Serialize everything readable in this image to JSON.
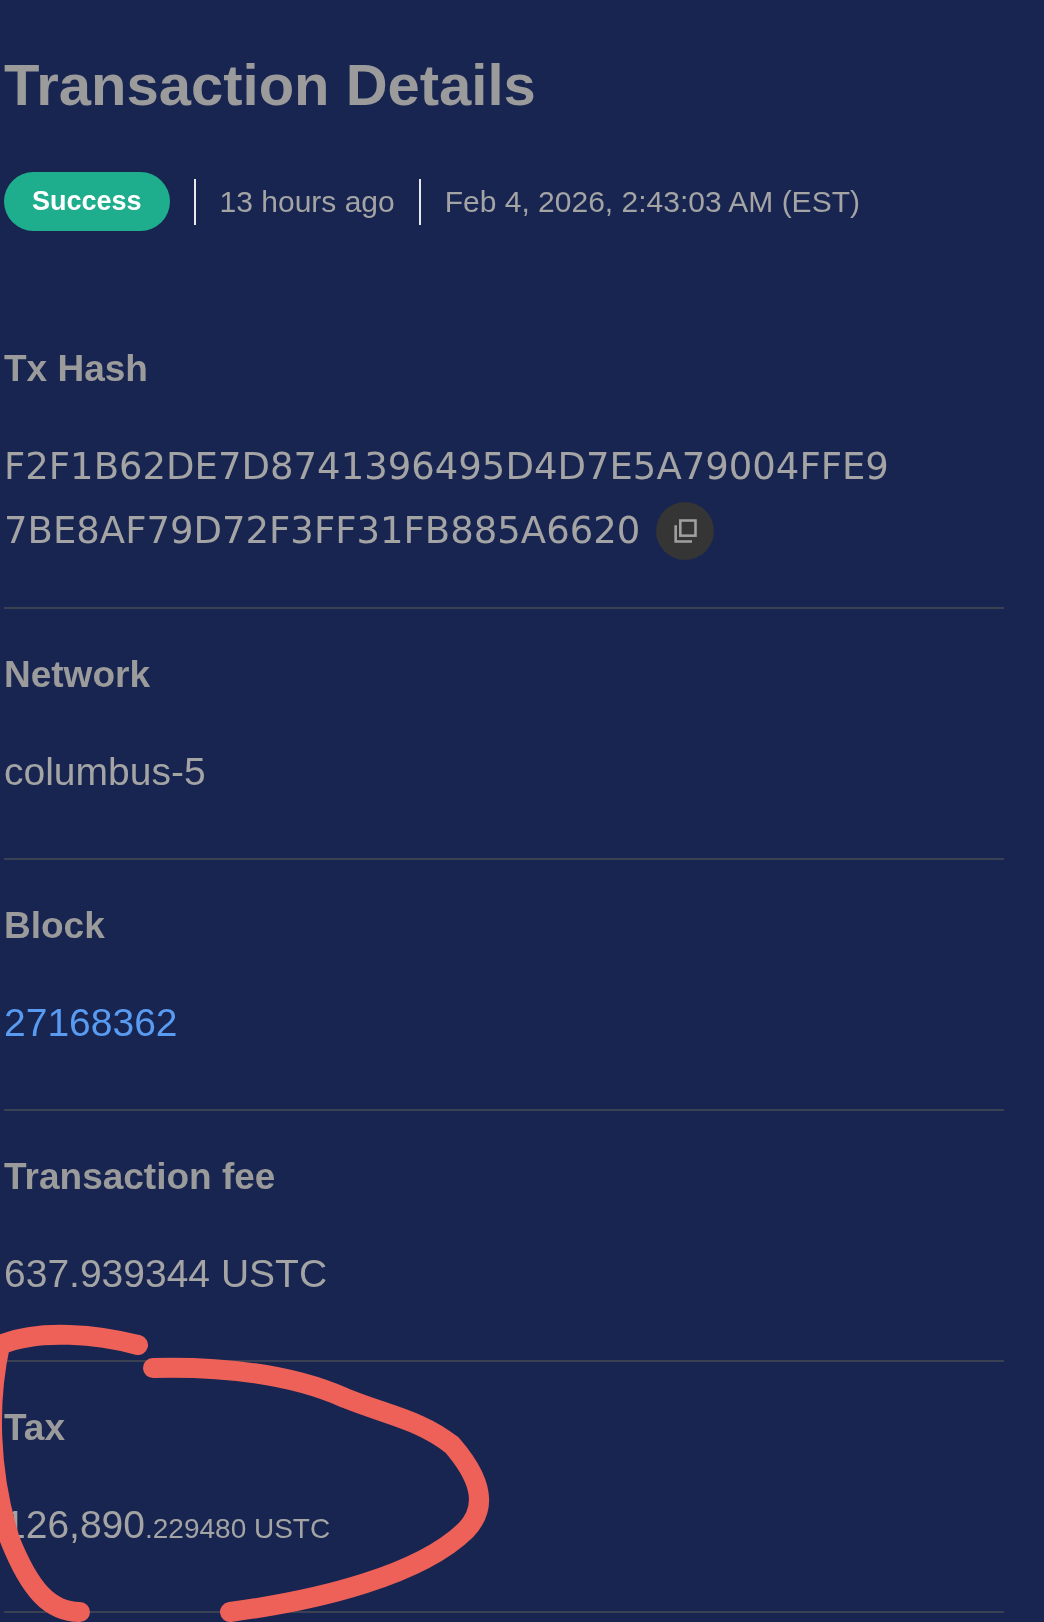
{
  "title": "Transaction Details",
  "status": {
    "label": "Success",
    "kind": "success"
  },
  "time_ago": "13 hours ago",
  "timestamp": "Feb 4, 2026, 2:43:03 AM (EST)",
  "fields": [
    {
      "label": "Tx Hash",
      "kind": "hash",
      "value": "F2F1B62DE7D8741396495D4D7E5A79004FFE9",
      "value_line_2": "7BE8AF79D72F3FF31FB885A6620"
    },
    {
      "label": "Network",
      "kind": "text",
      "value": "columbus-5"
    },
    {
      "label": "Block",
      "kind": "link",
      "value": "27168362"
    },
    {
      "label": "Transaction fee",
      "kind": "text",
      "value": "637.939344 USTC"
    },
    {
      "label": "Tax",
      "kind": "amount",
      "value": "126,890",
      "fraction": ".229480 USTC"
    }
  ]
}
